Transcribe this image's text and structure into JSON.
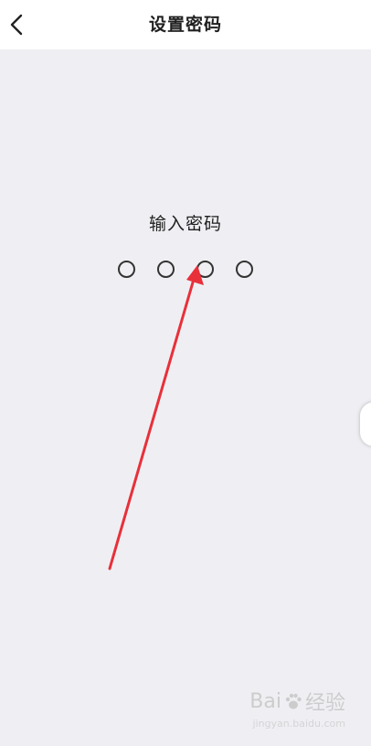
{
  "header": {
    "title": "设置密码",
    "back_icon": "chevron-left-icon"
  },
  "main": {
    "prompt": "输入密码",
    "pin_length": 4,
    "pin_entered": 0
  },
  "annotation": {
    "arrow_color": "#e8303a"
  },
  "watermark": {
    "brand_left": "Bai",
    "brand_right": "经验",
    "url": "jingyan.baidu.com"
  },
  "colors": {
    "background": "#efeff3",
    "header_bg": "#ffffff",
    "text": "#1f1f1f"
  }
}
